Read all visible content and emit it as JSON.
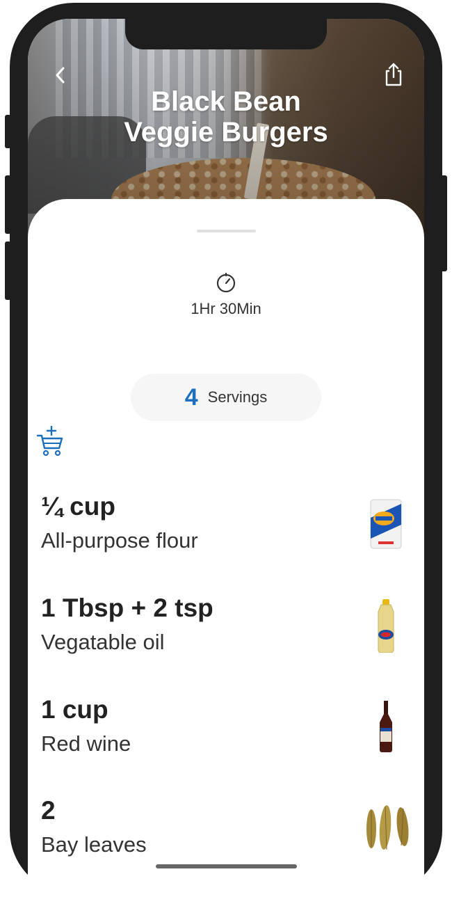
{
  "recipe": {
    "title_line1": "Black Bean",
    "title_line2": "Veggie Burgers",
    "time": "1Hr 30Min",
    "servings": {
      "count": "4",
      "label": "Servings"
    }
  },
  "ingredients": [
    {
      "amount": "¼ cup",
      "name": "All-purpose flour",
      "image_icon": "flour-bag-icon"
    },
    {
      "amount": "1 Tbsp + 2 tsp",
      "name": "Vegatable oil",
      "image_icon": "oil-bottle-icon"
    },
    {
      "amount": "1 cup",
      "name": "Red wine",
      "image_icon": "wine-bottle-icon"
    },
    {
      "amount": "2",
      "name": "Bay leaves",
      "image_icon": "bay-leaves-icon"
    }
  ],
  "icons": {
    "back": "chevron-left-icon",
    "share": "share-icon",
    "timer": "timer-icon",
    "cart": "add-to-cart-icon"
  },
  "colors": {
    "accent": "#1c6fbd",
    "text": "#222222",
    "phone_frame": "#1e1e1e"
  }
}
